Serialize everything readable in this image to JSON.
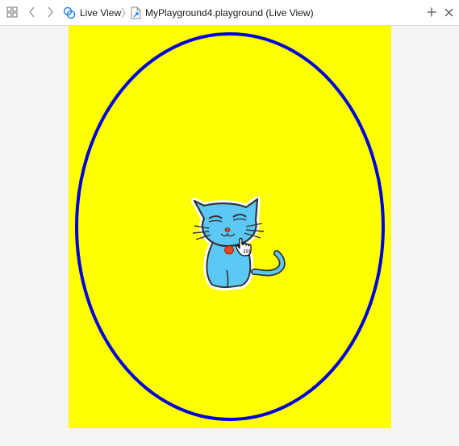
{
  "jumpbar": {
    "grid_icon": "grid-icon",
    "back_icon": "chevron-left-icon",
    "forward_icon": "chevron-right-icon",
    "breadcrumb": [
      {
        "label": "Live View",
        "icon": "live-view-rings-icon"
      },
      {
        "label": "MyPlayground4.playground (Live View)",
        "icon": "playground-file-icon"
      }
    ],
    "add_icon": "plus-icon",
    "close_icon": "close-icon"
  },
  "live_view": {
    "background_color": "#ffff00",
    "ellipse_stroke_color": "#0000dd",
    "cat_body_color": "#5bc8f5",
    "cat_collar_color": "#e8481e",
    "cursor_icon": "pointing-hand-cursor-icon"
  }
}
